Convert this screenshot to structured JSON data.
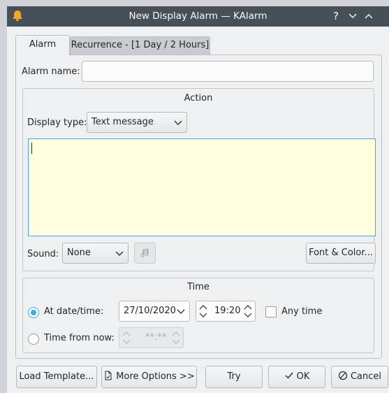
{
  "window": {
    "title": "New Display Alarm — KAlarm",
    "help_glyph": "?",
    "minimize_glyph": "⌄",
    "maximize_glyph": "⌃"
  },
  "tabs": [
    {
      "label": "Alarm",
      "active": true
    },
    {
      "label": "Recurrence - [1 Day / 2 Hours]",
      "active": false
    }
  ],
  "alarm_name": {
    "label": "Alarm name:",
    "value": ""
  },
  "action": {
    "title": "Action",
    "display_type_label": "Display type:",
    "display_type_value": "Text message",
    "message_text": "",
    "sound_label": "Sound:",
    "sound_value": "None",
    "font_color_button": "Font & Color..."
  },
  "time": {
    "title": "Time",
    "at_datetime_label": "At date/time:",
    "date_value": "27/10/2020",
    "time_value": "19:20",
    "any_time_label": "Any time",
    "time_from_now_label": "Time from now:",
    "time_from_now_value": "**:**"
  },
  "buttons": {
    "load_template": "Load Template...",
    "more_options": "More Options >>",
    "try": "Try",
    "ok": "OK",
    "cancel": "Cancel"
  },
  "colors": {
    "accent": "#3daee9",
    "titlebar": "#475057",
    "message_bg": "#ffffe0"
  }
}
